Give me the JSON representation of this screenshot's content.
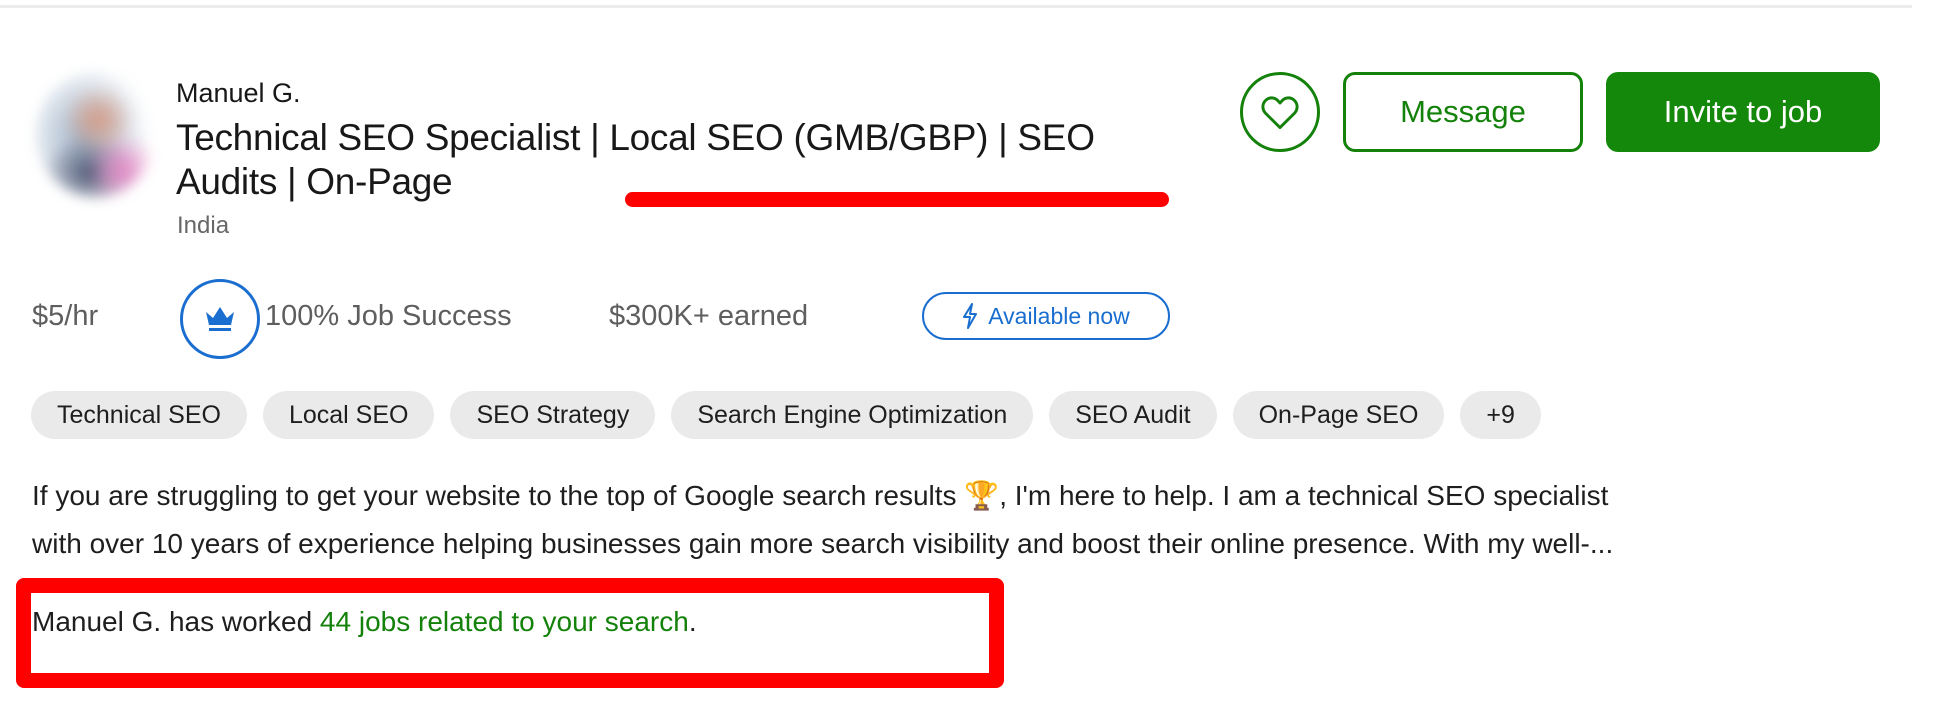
{
  "freelancer": {
    "name": "Manuel G.",
    "headline": "Technical SEO Specialist | Local SEO (GMB/GBP) | SEO Audits | On-Page",
    "location": "India",
    "avatar_icon": "avatar-photo-blurred"
  },
  "actions": {
    "save_icon": "heart-icon",
    "message_label": "Message",
    "invite_label": "Invite to job"
  },
  "stats": {
    "rate": "$5/hr",
    "job_success_icon": "crown-icon",
    "job_success": "100% Job Success",
    "earned": "$300K+ earned",
    "availability_icon": "lightning-bolt-icon",
    "availability": "Available now"
  },
  "skills": [
    "Technical SEO",
    "Local SEO",
    "SEO Strategy",
    "Search Engine Optimization",
    "SEO Audit",
    "On-Page SEO",
    "+9"
  ],
  "description": {
    "line1_pre": "If you are struggling to get your website to the top of Google search results ",
    "emoji": "🏆",
    "line1_post": ", I'm here to help. I am a technical SEO specialist",
    "line2": "with over 10 years of experience helping businesses gain more search visibility and boost their online presence. With my well-..."
  },
  "related_jobs": {
    "prefix": "Manuel G. has worked ",
    "link": "44 jobs related to your search",
    "suffix": "."
  },
  "colors": {
    "brand_green": "#14880a",
    "accent_blue": "#1a6ecf",
    "annotation_red": "#ff0000",
    "chip_bg": "#eaeaea"
  }
}
